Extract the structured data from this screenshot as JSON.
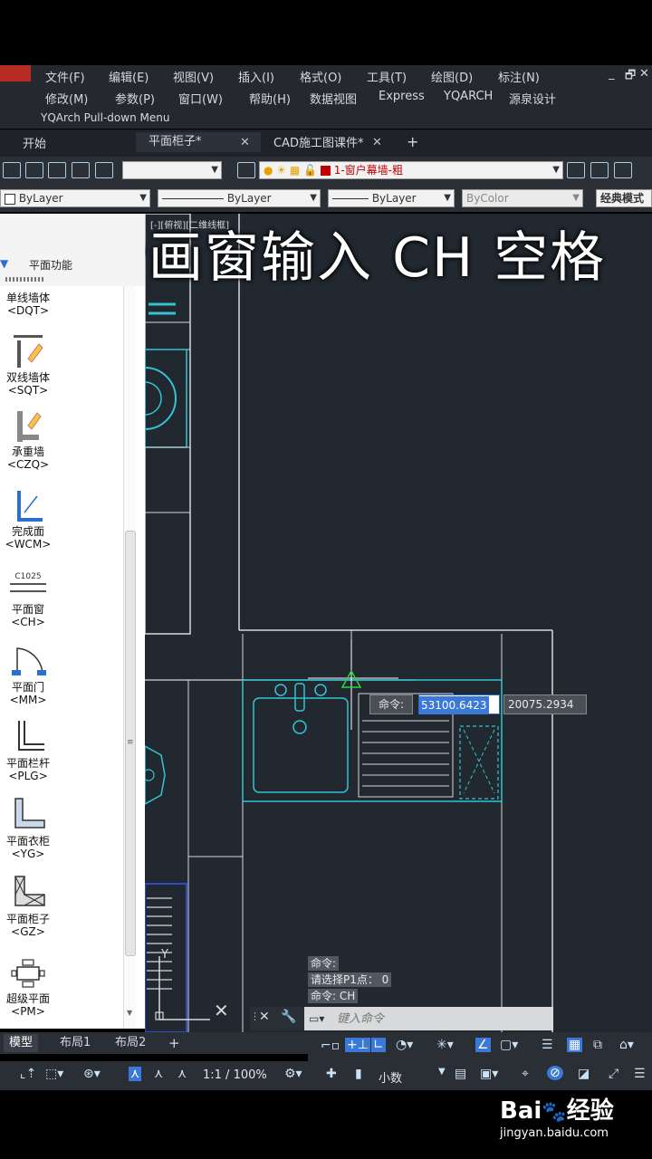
{
  "menu": {
    "row1": [
      "文件(F)",
      "编辑(E)",
      "视图(V)",
      "插入(I)",
      "格式(O)",
      "工具(T)",
      "绘图(D)",
      "标注(N)"
    ],
    "row2": [
      "修改(M)",
      "参数(P)",
      "窗口(W)",
      "帮助(H)",
      "数据视图",
      "Express",
      "YQARCH",
      "源泉设计"
    ],
    "row3": "YQArch Pull-down Menu",
    "window_controls": [
      "_",
      "🗗",
      "✕"
    ]
  },
  "tabs": {
    "items": [
      {
        "label": "开始"
      },
      {
        "label": "平面柜子*"
      },
      {
        "label": "CAD施工图课件*"
      }
    ],
    "add": "+",
    "close": "✕"
  },
  "toolbar1": {
    "layer_name": "1-窗户幕墙-粗"
  },
  "toolbar2": {
    "color": "ByLayer",
    "linetype": "ByLayer",
    "lineweight": "ByLayer",
    "plotstyle": "ByColor",
    "workspace": "经典模式"
  },
  "overlay_caption": "一秒画窗输入 CH 空格",
  "viewport_label": "[-][俯视][二维线框]",
  "palette": {
    "header": "平面功能",
    "items": [
      {
        "label": "单线墙体",
        "cmd": "<DQT>"
      },
      {
        "label": "双线墙体",
        "cmd": "<SQT>"
      },
      {
        "label": "承重墙",
        "cmd": "<CZQ>"
      },
      {
        "label": "完成面",
        "cmd": "<WCM>"
      },
      {
        "label": "平面窗",
        "cmd": "<CH>",
        "icon_text": "C1025"
      },
      {
        "label": "平面门",
        "cmd": "<MM>"
      },
      {
        "label": "平面栏杆",
        "cmd": "<PLG>"
      },
      {
        "label": "平面衣柜",
        "cmd": "<YG>"
      },
      {
        "label": "平面柜子",
        "cmd": "<GZ>"
      },
      {
        "label": "超级平面",
        "cmd": "<PM>"
      }
    ]
  },
  "command_tooltip": {
    "label": "命令:",
    "x": "53100.6423",
    "y": "20075.2934"
  },
  "command_history": [
    "命令:",
    "请选择P1点： 0",
    "命令: CH"
  ],
  "command_input_placeholder": "键入命令",
  "layout_tabs": [
    "模型",
    "布局1",
    "布局2",
    "+"
  ],
  "status": {
    "scale": "1:1 / 100%",
    "units": "小数"
  },
  "watermark": {
    "brand": "Bai",
    "brand_suffix": "经验",
    "url": "jingyan.baidu.com"
  }
}
